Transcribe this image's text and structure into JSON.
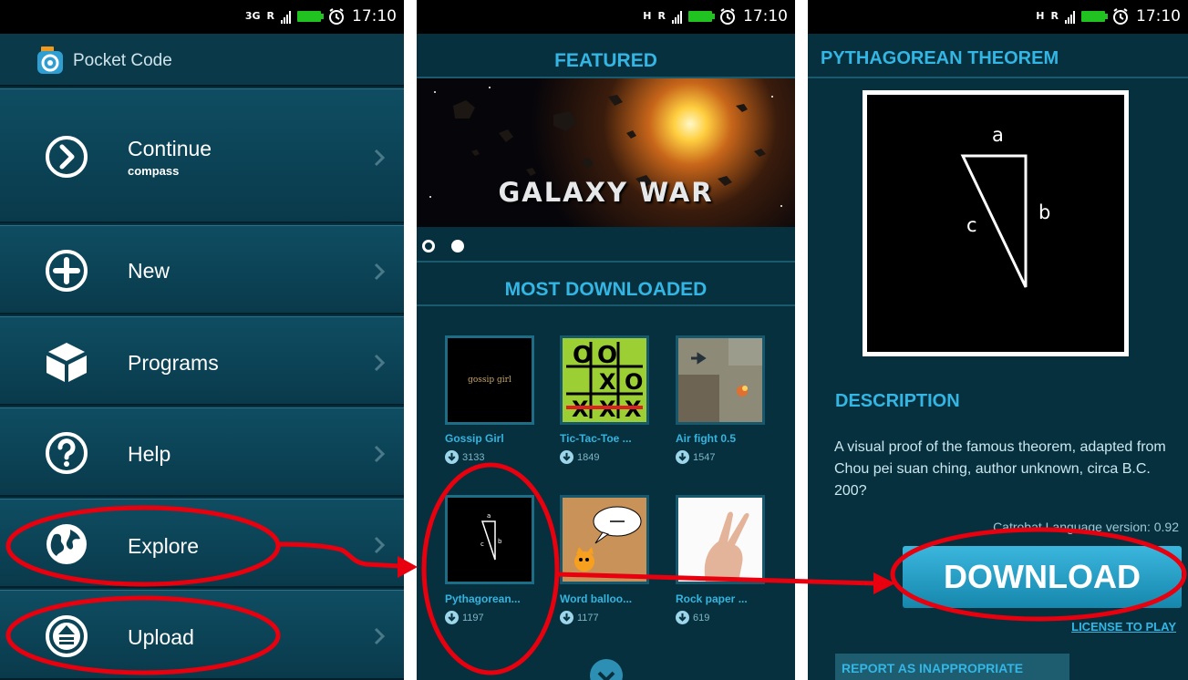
{
  "status_bar": {
    "time": "17:10",
    "network_left": "3G",
    "network_other": "H",
    "roaming": "R"
  },
  "menu_screen": {
    "app_title": "Pocket Code",
    "items": [
      {
        "icon": "continue-arrow-icon",
        "label": "Continue",
        "sublabel": "compass"
      },
      {
        "icon": "plus-icon",
        "label": "New"
      },
      {
        "icon": "cube-icon",
        "label": "Programs"
      },
      {
        "icon": "question-icon",
        "label": "Help"
      },
      {
        "icon": "globe-icon",
        "label": "Explore"
      },
      {
        "icon": "upload-icon",
        "label": "Upload"
      }
    ]
  },
  "explore_screen": {
    "featured_title": "FEATURED",
    "banner_text": "GALAXY WAR",
    "pager_active_index": 1,
    "most_downloaded_title": "MOST DOWNLOADED",
    "programs": [
      {
        "name": "Gossip Girl",
        "downloads": "3133",
        "thumb_text": "gossip girl"
      },
      {
        "name": "Tic-Tac-Toe ...",
        "downloads": "1849"
      },
      {
        "name": "Air fight 0.5",
        "downloads": "1547"
      },
      {
        "name": "Pythagorean...",
        "downloads": "1197"
      },
      {
        "name": "Word balloo...",
        "downloads": "1177"
      },
      {
        "name": "Rock paper ...",
        "downloads": "619"
      }
    ]
  },
  "program_screen": {
    "title": "PYTHAGOREAN THEOREM",
    "triangle_labels": {
      "a": "a",
      "b": "b",
      "c": "c"
    },
    "description_heading": "DESCRIPTION",
    "description": "A visual proof of the famous theorem, adapted from Chou pei suan ching, author unknown, circa B.C. 200?",
    "language_version": "Catrobat Language version: 0.92",
    "download_label": "DOWNLOAD",
    "license_label": "LICENSE TO PLAY",
    "report_label": "REPORT AS INAPPROPRIATE"
  },
  "colors": {
    "accent": "#34b6e4",
    "background": "#06303d",
    "annotation": "#e8000e"
  }
}
